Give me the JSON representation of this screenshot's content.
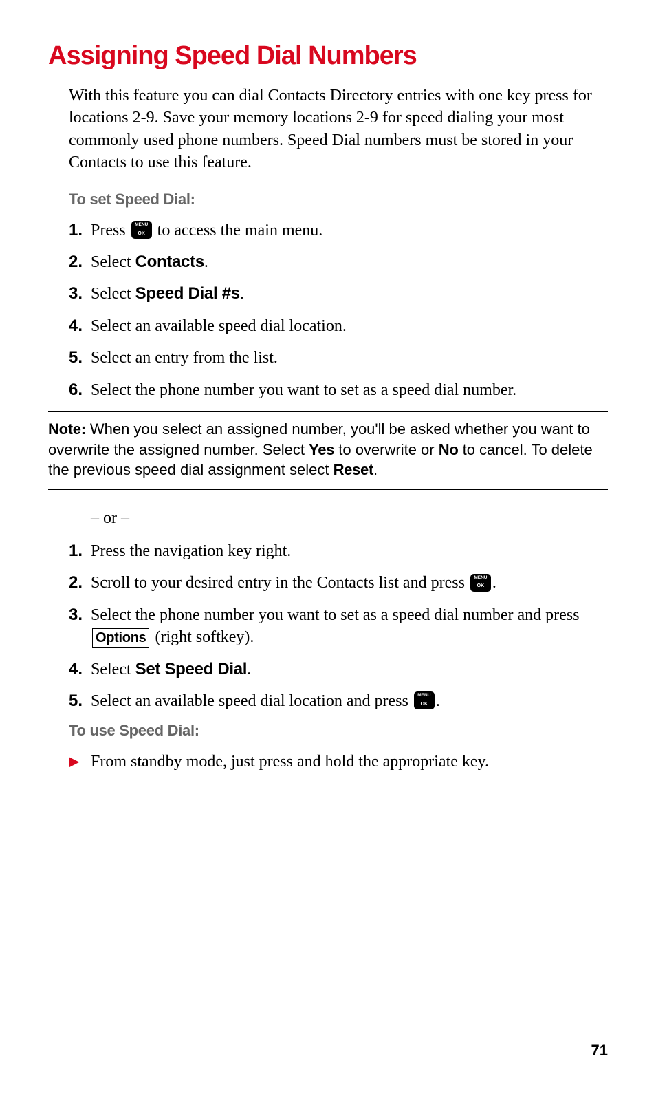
{
  "heading": "Assigning Speed Dial Numbers",
  "intro": "With this feature you can dial Contacts Directory entries with one key press for locations 2-9. Save your memory locations 2-9 for speed dialing your most commonly used phone numbers. Speed Dial numbers must be stored in your Contacts to use this feature.",
  "sub1": "To set Speed Dial:",
  "steps1": {
    "s1a": "Press ",
    "s1b": " to access the main menu.",
    "s2a": "Select ",
    "s2b": "Contacts",
    "s2c": ".",
    "s3a": "Select ",
    "s3b": "Speed Dial #s",
    "s3c": ".",
    "s4": "Select an available speed dial location.",
    "s5": "Select an entry from the list.",
    "s6": "Select the phone number you want to set as a speed dial number."
  },
  "note": {
    "label": "Note:",
    "p1": " When you select an assigned number, you'll be asked whether you want to overwrite the assigned number. Select ",
    "yes": "Yes",
    "p2": " to overwrite or ",
    "no": "No",
    "p3": " to cancel. To delete the previous speed dial assignment select ",
    "reset": "Reset",
    "p4": "."
  },
  "or": "– or –",
  "steps2": {
    "s1": "Press the navigation key right.",
    "s2a": "Scroll to your desired entry in the Contacts list and press ",
    "s2b": ".",
    "s3a": "Select the phone number you want to set as a speed dial number and press ",
    "s3b": "Options",
    "s3c": " (right softkey).",
    "s4a": "Select ",
    "s4b": "Set Speed Dial",
    "s4c": ".",
    "s5a": "Select an available speed dial location and press ",
    "s5b": "."
  },
  "sub2": "To use Speed Dial:",
  "bullet": "From standby mode, just press and hold the appropriate key.",
  "nums": {
    "n1": "1.",
    "n2": "2.",
    "n3": "3.",
    "n4": "4.",
    "n5": "5.",
    "n6": "6."
  },
  "pagenum": "71"
}
